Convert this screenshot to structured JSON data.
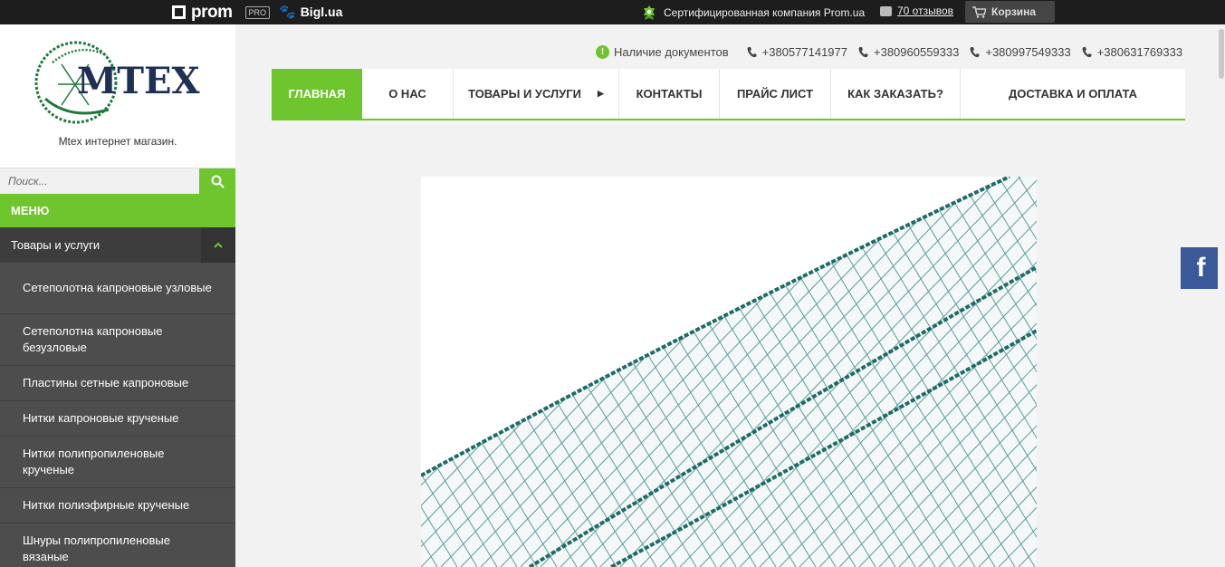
{
  "topbar": {
    "prom_label": "prom",
    "pro_badge": "PRO",
    "bigl_label": "Bigl.ua",
    "certified_text": "Сертифицированная компания Prom.ua",
    "reviews_text": "70 отзывов",
    "cart_label": "Корзина"
  },
  "sidebar": {
    "logo_text": "MTEX",
    "logo_caption": "Mtex интернет магазин.",
    "search_placeholder": "Поиск...",
    "menu_title": "МЕНЮ",
    "category_title": "Товары и услуги",
    "items": [
      {
        "label": "Сетеполотна капроновые узловые",
        "lines": 2
      },
      {
        "label": "Сетеполотна капроновые безузловые",
        "lines": 2
      },
      {
        "label": "Пластины сетные капроновые",
        "lines": 1
      },
      {
        "label": "Нитки капроновые крученые",
        "lines": 1
      },
      {
        "label": "Нитки полипропиленовые крученые",
        "lines": 2
      },
      {
        "label": "Нитки полиэфирные крученые",
        "lines": 1
      },
      {
        "label": "Шнуры полипропиленовые вязаные",
        "lines": 2
      }
    ]
  },
  "contacts": {
    "documents_label": "Наличие документов",
    "phones": [
      "+380577141977",
      "+380960559333",
      "+380997549333",
      "+380631769333"
    ]
  },
  "nav": {
    "items": [
      {
        "label": "Главная",
        "active": true
      },
      {
        "label": "О нас",
        "active": false
      },
      {
        "label": "Товары и услуги",
        "active": false,
        "has_arrow": true
      },
      {
        "label": "Контакты",
        "active": false
      },
      {
        "label": "Прайс лист",
        "active": false
      },
      {
        "label": "Как заказать?",
        "active": false
      },
      {
        "label": "Доставка и оплата",
        "active": false
      }
    ]
  },
  "social": {
    "facebook_glyph": "f"
  },
  "colors": {
    "accent": "#6fc52e",
    "topbar": "#1d1d1d",
    "sidebar_dark": "#4d4d4d",
    "facebook": "#3b5998",
    "logo_navy": "#1f3056",
    "logo_green": "#1e7a3c",
    "net_teal": "#2a7f7c"
  }
}
